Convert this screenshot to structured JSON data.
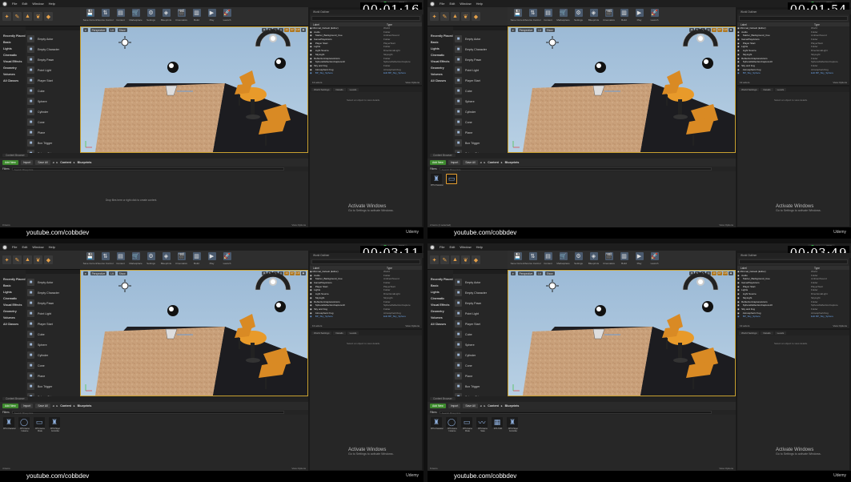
{
  "panels": [
    {
      "timer": "00:01:16",
      "state": "empty",
      "assets": [],
      "count": "0 items"
    },
    {
      "timer": "00:01:54",
      "state": "assets",
      "assets": [
        {
          "label": "FPS Character",
          "icon": "robot"
        },
        {
          "label": "",
          "icon": "panel",
          "selected": true
        }
      ],
      "count": "2 items (1 selected)"
    },
    {
      "timer": "00:03:11",
      "state": "assets",
      "assets": [
        {
          "label": "FPS Character",
          "icon": "robot"
        },
        {
          "label": "FPS Game Instance",
          "icon": "ring"
        },
        {
          "label": "FPS Game Mode",
          "icon": "panel"
        },
        {
          "label": "FPS Player Controller",
          "icon": "robot"
        }
      ],
      "count": "4 items"
    },
    {
      "timer": "00:03:49",
      "state": "assets",
      "assets": [
        {
          "label": "FPS Character",
          "icon": "robot"
        },
        {
          "label": "FPS Game Instance",
          "icon": "ring"
        },
        {
          "label": "FPS Game Mode",
          "icon": "panel"
        },
        {
          "label": "FPS Game State",
          "icon": "graph"
        },
        {
          "label": "FPS HUD",
          "icon": "hud"
        },
        {
          "label": "FPS Player Controller",
          "icon": "robot"
        }
      ],
      "count": "6 items"
    }
  ],
  "menu": [
    "File",
    "Edit",
    "Window",
    "Help"
  ],
  "udemy": "Udemy_FPS",
  "toolbar": [
    "Save Current",
    "Source Control",
    "Content",
    "Marketplace",
    "Settings",
    "Blueprints",
    "Cinematics",
    "Build",
    "Play",
    "Launch"
  ],
  "place_categories": [
    "Recently Placed",
    "Basic",
    "Lights",
    "Cinematic",
    "Visual Effects",
    "Geometry",
    "Volumes",
    "All Classes"
  ],
  "place_items": [
    "Empty Actor",
    "Empty Character",
    "Empty Pawn",
    "Point Light",
    "Player Start",
    "Cube",
    "Sphere",
    "Cylinder",
    "Cone",
    "Plane",
    "Box Trigger",
    "Sphere Trigger"
  ],
  "viewport": {
    "perspective": "Perspective",
    "lit": "Lit",
    "show": "Show",
    "snap_val": "10",
    "angle_val": "10°",
    "scale_val": "0.25"
  },
  "status_tab": "Content Browser",
  "content_browser": {
    "add_new": "Add New",
    "import": "Import",
    "save_all": "Save All",
    "crumb_content": "Content",
    "crumb_bp": "Blueprints",
    "filters": "Filters",
    "search": "Search Blueprints",
    "empty_hint": "Drop files here or right click to create content.",
    "view_options": "View Options"
  },
  "outliner": {
    "tab": "World Outliner",
    "col_label": "Label",
    "col_type": "Type",
    "rows": [
      {
        "label": "Minimal_Default (Editor)",
        "type": "World",
        "blue": false
      },
      {
        "label": "  Audio",
        "type": "Folder",
        "blue": false
      },
      {
        "label": "    Starter_Background_Cue",
        "type": "AmbientSound",
        "blue": false
      },
      {
        "label": "  GamePlayActors",
        "type": "Folder",
        "blue": false
      },
      {
        "label": "    Player Start",
        "type": "PlayerStart",
        "blue": false
      },
      {
        "label": "  Lights",
        "type": "Folder",
        "blue": false
      },
      {
        "label": "    Light Source",
        "type": "DirectionalLight",
        "blue": false
      },
      {
        "label": "    SkyLight",
        "type": "SkyLight",
        "blue": false
      },
      {
        "label": "  ReflectionCaptureActors",
        "type": "Folder",
        "blue": false
      },
      {
        "label": "    SphereReflectionCapture10",
        "type": "SphereReflectionCapture",
        "blue": false
      },
      {
        "label": "  Sky and Fog",
        "type": "Folder",
        "blue": false
      },
      {
        "label": "    Atmospheric Fog",
        "type": "AtmosphericFog",
        "blue": false
      },
      {
        "label": "    BP_Sky_Sphere",
        "type": "Edit BP_Sky_Sphere",
        "blue": true
      }
    ],
    "actors": "13 actors",
    "view_options": "View Options"
  },
  "details": {
    "tab1": "World Settings",
    "tab2": "Details",
    "tab3": "Levels",
    "hint": "Select an object to view details."
  },
  "activate": {
    "line1": "Activate Windows",
    "line2": "Go to Settings to activate Windows."
  },
  "yt": "youtube.com/cobbdev",
  "udemy_brand": "Udemy",
  "colors": {
    "accent": "#c8a030",
    "sky": "#a9c4dc",
    "floor": "#c9a07a",
    "green": "#3e8a2e"
  }
}
